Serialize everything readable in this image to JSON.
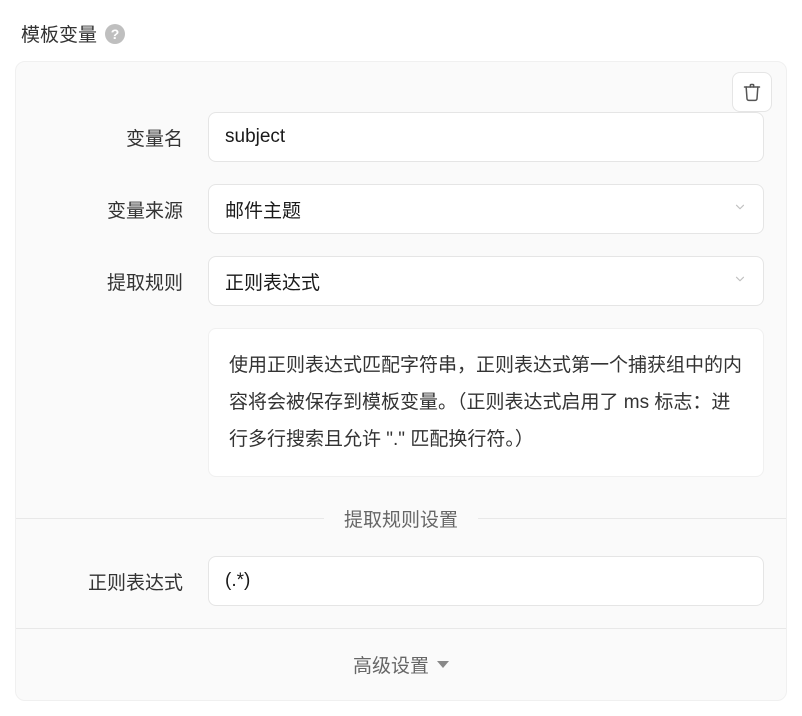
{
  "header": {
    "title": "模板变量"
  },
  "form": {
    "name_label": "变量名",
    "name_value": "subject",
    "source_label": "变量来源",
    "source_value": "邮件主题",
    "rule_label": "提取规则",
    "rule_value": "正则表达式",
    "help_text": "使用正则表达式匹配字符串，正则表达式第一个捕获组中的内容将会被保存到模板变量。（正则表达式启用了 ms 标志：进行多行搜索且允许 \".\" 匹配换行符。）",
    "divider_rule": "提取规则设置",
    "regex_label": "正则表达式",
    "regex_value": "(.*)",
    "advanced_label": "高级设置"
  }
}
